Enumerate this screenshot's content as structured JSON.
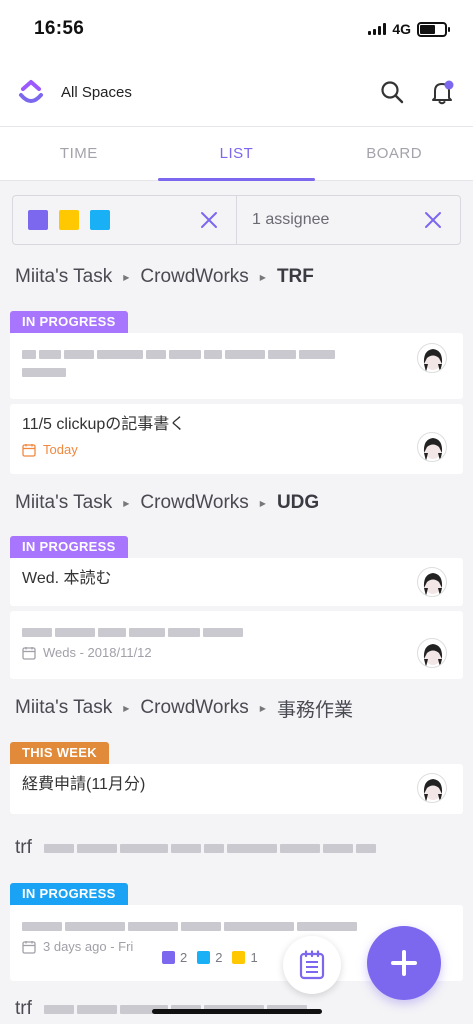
{
  "status_bar": {
    "time": "16:56",
    "network": "4G"
  },
  "header": {
    "title": "All Spaces"
  },
  "tabs": [
    {
      "label": "TIME"
    },
    {
      "label": "LIST"
    },
    {
      "label": "BOARD"
    }
  ],
  "filter": {
    "colors": [
      "#7b68ee",
      "#ffc800",
      "#1ab0f5"
    ],
    "assignee_text": "1 assignee"
  },
  "groups": [
    {
      "breadcrumb": [
        "Miita's Task",
        "CrowdWorks",
        "TRF"
      ],
      "status": "IN PROGRESS",
      "tasks": [
        {
          "title": "",
          "meta": ""
        },
        {
          "title": "11/5 clickupの記事書く",
          "meta": "Today"
        }
      ]
    },
    {
      "breadcrumb": [
        "Miita's Task",
        "CrowdWorks",
        "UDG"
      ],
      "status": "IN PROGRESS",
      "tasks": [
        {
          "title": "Wed. 本読む",
          "meta": ""
        },
        {
          "title": "",
          "meta": "Weds - 2018/11/12"
        }
      ]
    },
    {
      "breadcrumb": [
        "Miita's Task",
        "CrowdWorks",
        "事務作業"
      ],
      "status": "THIS WEEK",
      "tasks": [
        {
          "title": "経費申請(11月分)",
          "meta": ""
        }
      ]
    },
    {
      "breadcrumb": [
        "trf"
      ],
      "status": "IN PROGRESS",
      "tasks": [
        {
          "title": "",
          "meta": "3 days ago - Fri"
        }
      ]
    },
    {
      "breadcrumb": [
        "trf"
      ]
    }
  ],
  "counts": [
    {
      "color": "#7b68ee",
      "value": "2"
    },
    {
      "color": "#1ab0f5",
      "value": "2"
    },
    {
      "color": "#ffc800",
      "value": "1"
    }
  ]
}
